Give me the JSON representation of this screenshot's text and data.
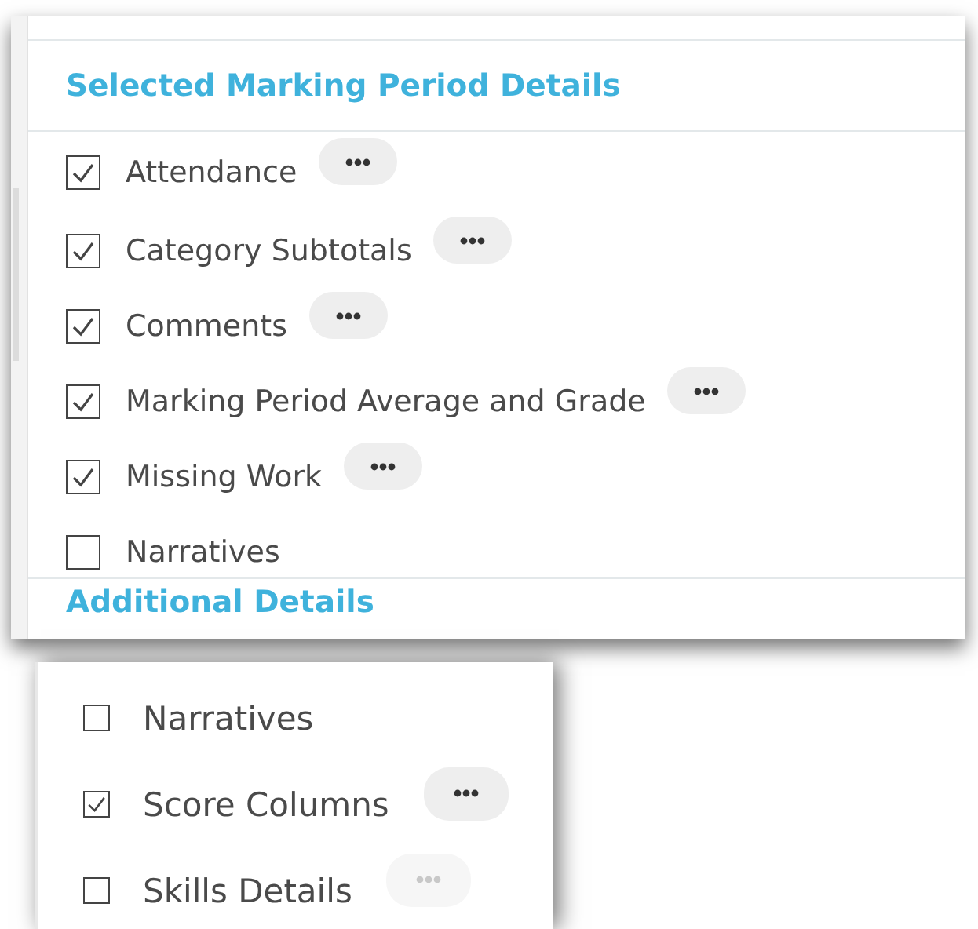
{
  "panels": [
    {
      "title": "Selected Marking Period Details",
      "items": [
        {
          "label": "Attendance",
          "checked": true,
          "options": {
            "disabled": false
          }
        },
        {
          "label": "Category Subtotals",
          "checked": true,
          "options": {
            "disabled": false
          }
        },
        {
          "label": "Comments",
          "checked": true,
          "options": {
            "disabled": false
          }
        },
        {
          "label": "Marking Period Average and Grade",
          "checked": true,
          "options": {
            "disabled": false
          }
        },
        {
          "label": "Missing Work",
          "checked": true,
          "options": {
            "disabled": false
          }
        },
        {
          "label": "Narratives",
          "checked": false
        }
      ],
      "next_section": "Additional Details"
    },
    {
      "items": [
        {
          "label": "Narratives",
          "checked": false
        },
        {
          "label": "Score Columns",
          "checked": true,
          "options": {
            "disabled": false
          }
        },
        {
          "label": "Skills Details",
          "checked": false,
          "options": {
            "disabled": true
          }
        }
      ]
    }
  ]
}
